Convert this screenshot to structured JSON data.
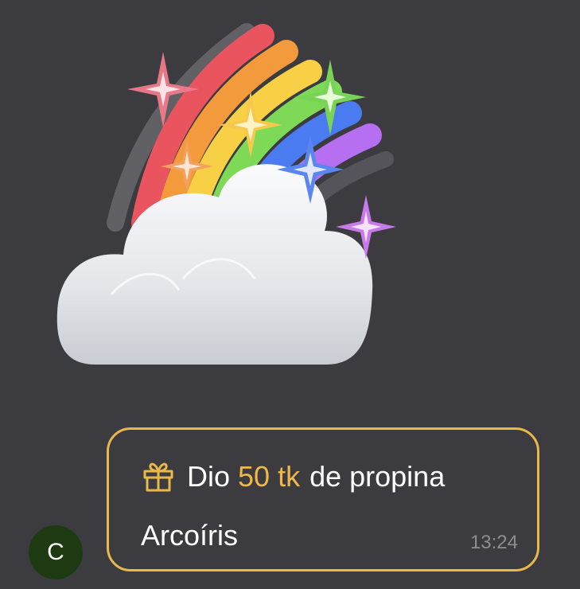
{
  "colors": {
    "background": "#3b3b40",
    "accent": "#e9b84a",
    "avatar_background": "#1e3a12"
  },
  "sticker": {
    "icon": "rainbow-cloud-sticker"
  },
  "message": {
    "avatar_initial": "C",
    "tip_verb": "Dio",
    "tip_amount": "50 tk",
    "tip_suffix": "de propina",
    "sticker_name": "Arcoíris",
    "timestamp": "13:24",
    "icon": "gift-icon"
  }
}
